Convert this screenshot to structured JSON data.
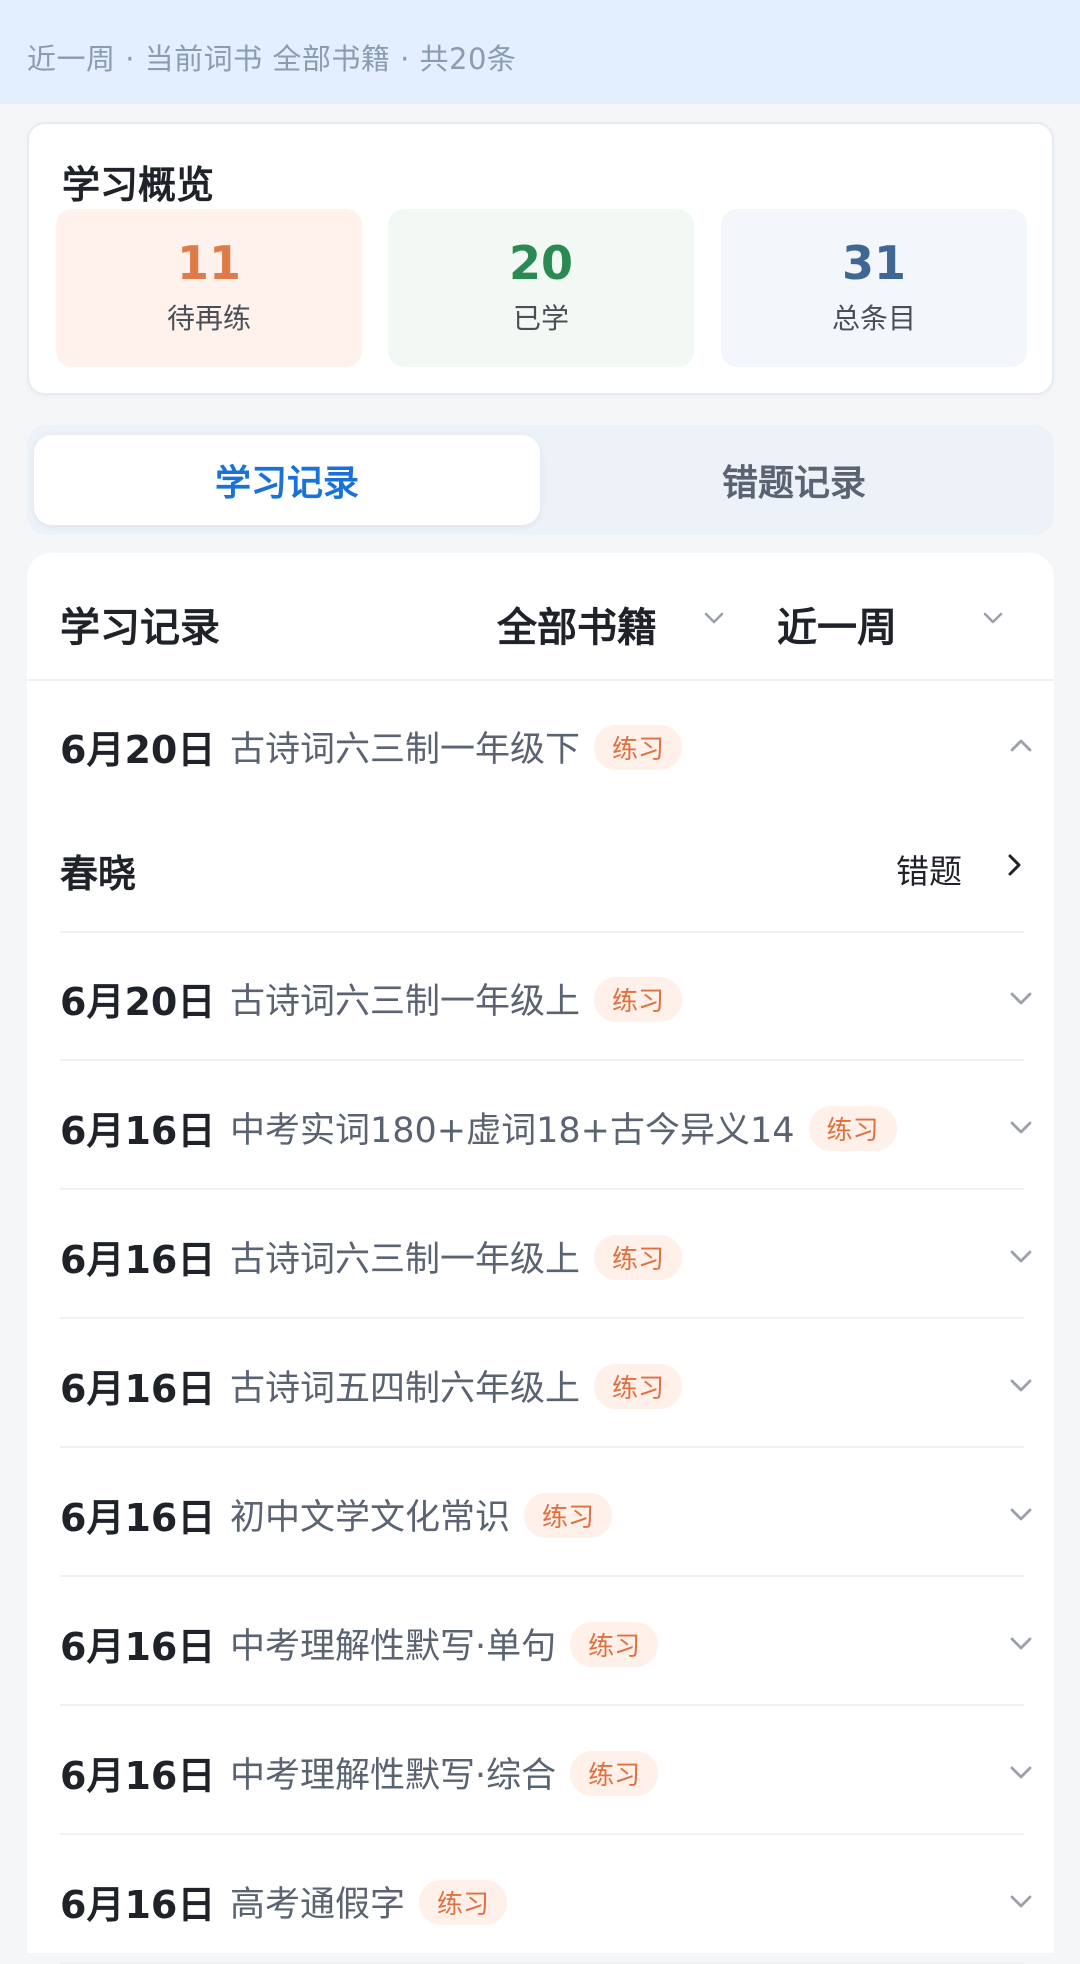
{
  "banner": {
    "text": "近一周 · 当前词书 全部书籍 · 共20条"
  },
  "overview": {
    "title": "学习概览",
    "stats": [
      {
        "value": "11",
        "label": "待再练"
      },
      {
        "value": "20",
        "label": "已学"
      },
      {
        "value": "31",
        "label": "总条目"
      }
    ]
  },
  "tabs": [
    {
      "label": "学习记录",
      "active": true
    },
    {
      "label": "错题记录",
      "active": false
    }
  ],
  "records": {
    "title": "学习记录",
    "filter_book": "全部书籍",
    "filter_range": "近一周",
    "expanded": {
      "date": "6月20日",
      "book": "古诗词六三制一年级下",
      "tag": "练习",
      "items": [
        {
          "title": "春晓",
          "action": "错题"
        }
      ]
    },
    "rows": [
      {
        "date": "6月20日",
        "book": "古诗词六三制一年级上",
        "tag": "练习"
      },
      {
        "date": "6月16日",
        "book": "中考实词180+虚词18+古今异义14",
        "tag": "练习"
      },
      {
        "date": "6月16日",
        "book": "古诗词六三制一年级上",
        "tag": "练习"
      },
      {
        "date": "6月16日",
        "book": "古诗词五四制六年级上",
        "tag": "练习"
      },
      {
        "date": "6月16日",
        "book": "初中文学文化常识",
        "tag": "练习"
      },
      {
        "date": "6月16日",
        "book": "中考理解性默写·单句",
        "tag": "练习"
      },
      {
        "date": "6月16日",
        "book": "中考理解性默写·综合",
        "tag": "练习"
      },
      {
        "date": "6月16日",
        "book": "高考通假字",
        "tag": "练习"
      }
    ]
  }
}
